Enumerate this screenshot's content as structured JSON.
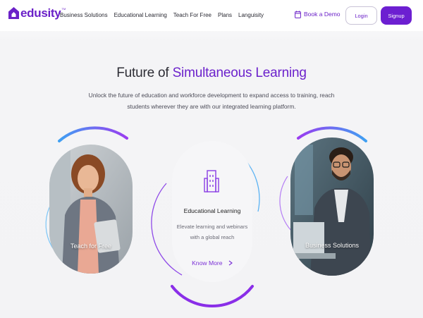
{
  "nav": {
    "brand": "edusity",
    "brand_tm": "TM",
    "links": [
      "Business Solutions",
      "Educational Learning",
      "Teach For Free",
      "Plans",
      "Languisity"
    ],
    "demo_label": "Book a Demo",
    "login_label": "Login",
    "signup_label": "Signup"
  },
  "hero": {
    "title_plain": "Future of ",
    "title_accent": "Simultaneous Learning",
    "description": "Unlock the future of education and workforce development to expand access to training, reach students wherever they are with our integrated learning platform."
  },
  "cards": {
    "left_label": "Teach for Free",
    "right_label": "Business Solutions",
    "center": {
      "title": "Educational Learning",
      "description": "Elevate learning and webinars with a global reach",
      "link": "Know More"
    }
  },
  "colors": {
    "brand_purple": "#6c1fd1",
    "accent_blue": "#3aa6f0"
  },
  "icons": [
    "home-logo-icon",
    "calendar-icon",
    "building-icon",
    "chevron-right-icon"
  ]
}
